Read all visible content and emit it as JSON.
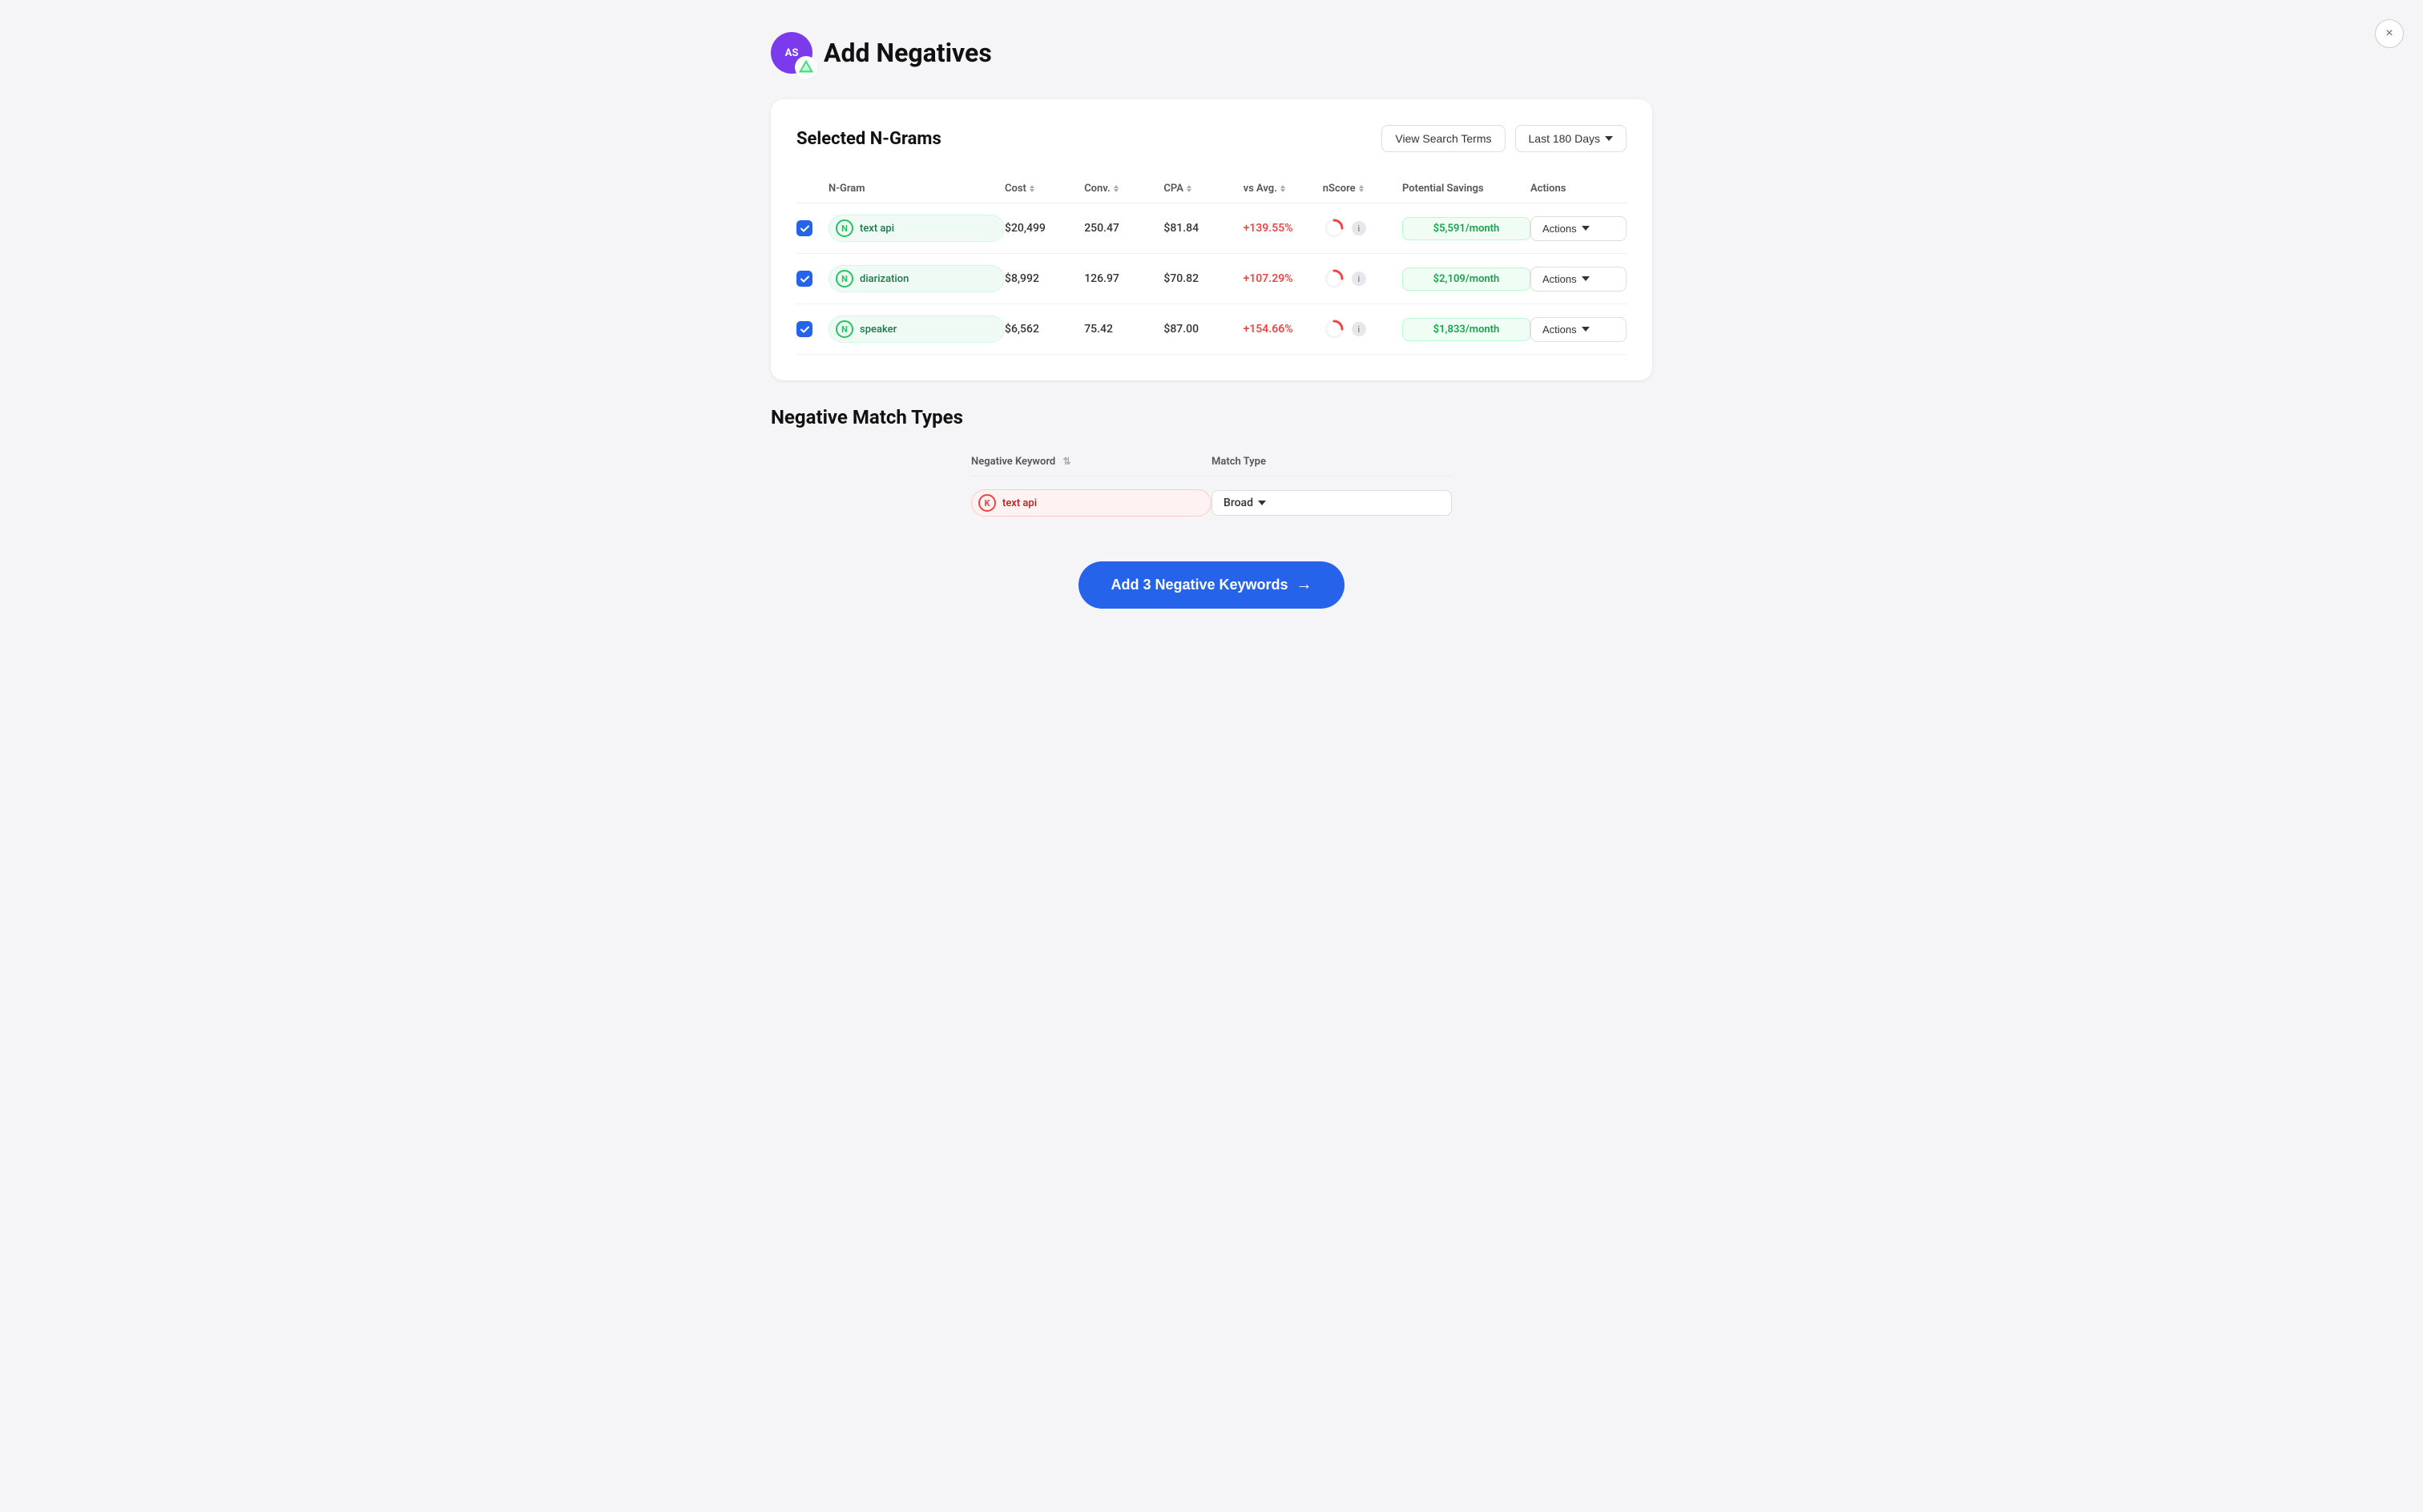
{
  "app": {
    "logo_text": "AS",
    "title": "Add Negatives",
    "close_label": "×"
  },
  "selected_ngrams": {
    "section_title": "Selected N-Grams",
    "view_search_terms_label": "View Search Terms",
    "date_range_label": "Last 180 Days",
    "table": {
      "headers": {
        "ngram": "N-Gram",
        "cost": "Cost",
        "conv": "Conv.",
        "cpa": "CPA",
        "vs_avg": "vs Avg.",
        "nscore": "nScore",
        "potential_savings": "Potential Savings",
        "actions": "Actions"
      },
      "rows": [
        {
          "checked": true,
          "ngram": "text api",
          "cost": "$20,499",
          "conv": "250.47",
          "cpa": "$81.84",
          "vs_avg": "+139.55%",
          "savings": "$5,591/month",
          "actions_label": "Actions"
        },
        {
          "checked": true,
          "ngram": "diarization",
          "cost": "$8,992",
          "conv": "126.97",
          "cpa": "$70.82",
          "vs_avg": "+107.29%",
          "savings": "$2,109/month",
          "actions_label": "Actions"
        },
        {
          "checked": true,
          "ngram": "speaker",
          "cost": "$6,562",
          "conv": "75.42",
          "cpa": "$87.00",
          "vs_avg": "+154.66%",
          "savings": "$1,833/month",
          "actions_label": "Actions"
        }
      ]
    }
  },
  "negative_match_types": {
    "section_title": "Negative Match Types",
    "headers": {
      "keyword": "Negative Keyword",
      "match_type": "Match Type"
    },
    "rows": [
      {
        "keyword": "text api",
        "match_type": "Broad"
      }
    ]
  },
  "add_button": {
    "label": "Add 3 Negative Keywords",
    "arrow": "→"
  }
}
